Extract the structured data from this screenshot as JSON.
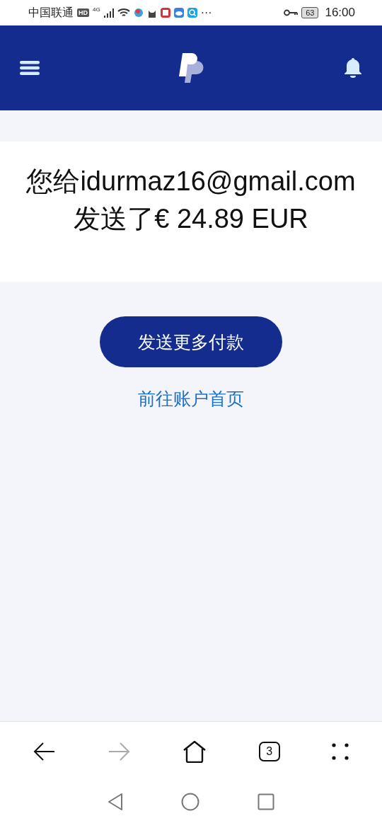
{
  "status_bar": {
    "carrier": "中国联通",
    "hd_badge": "HD",
    "network": "4G",
    "more": "···",
    "battery": "63",
    "time": "16:00"
  },
  "confirmation": {
    "message": "您给idurmaz16@gmail.com发送了€ 24.89 EUR"
  },
  "actions": {
    "primary": "发送更多付款",
    "link": "前往账户首页"
  },
  "browser_bar": {
    "back_disabled": false,
    "forward_disabled": true,
    "tab_count": "3"
  }
}
